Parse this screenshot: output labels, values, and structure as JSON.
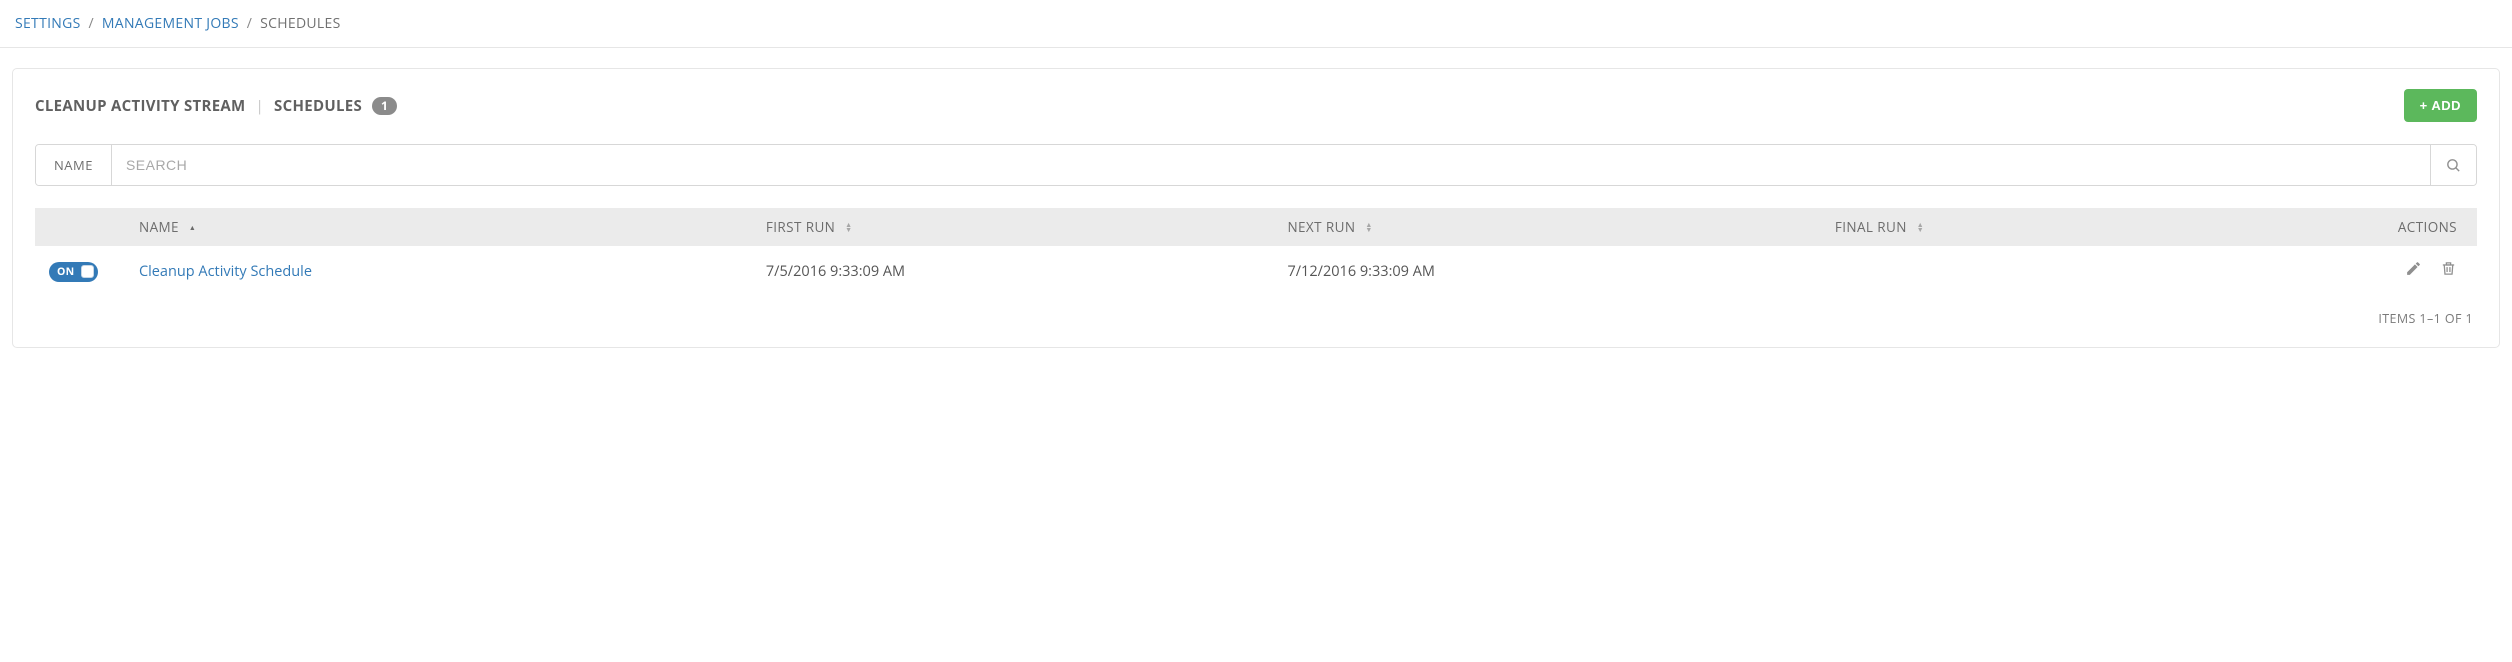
{
  "breadcrumb": {
    "items": [
      {
        "label": "SETTINGS"
      },
      {
        "label": "MANAGEMENT JOBS"
      }
    ],
    "current": "SCHEDULES"
  },
  "header": {
    "title": "CLEANUP ACTIVITY STREAM",
    "subtitle": "SCHEDULES",
    "count": "1",
    "add_label": "+ ADD"
  },
  "search": {
    "field_label": "NAME",
    "placeholder": "SEARCH"
  },
  "table": {
    "columns": {
      "name": "NAME",
      "first_run": "FIRST RUN",
      "next_run": "NEXT RUN",
      "final_run": "FINAL RUN",
      "actions": "ACTIONS"
    },
    "rows": [
      {
        "toggle": "ON",
        "name": "Cleanup Activity Schedule",
        "first_run": "7/5/2016 9:33:09 AM",
        "next_run": "7/12/2016 9:33:09 AM",
        "final_run": ""
      }
    ]
  },
  "pager": {
    "text": "ITEMS 1–1 OF 1"
  }
}
